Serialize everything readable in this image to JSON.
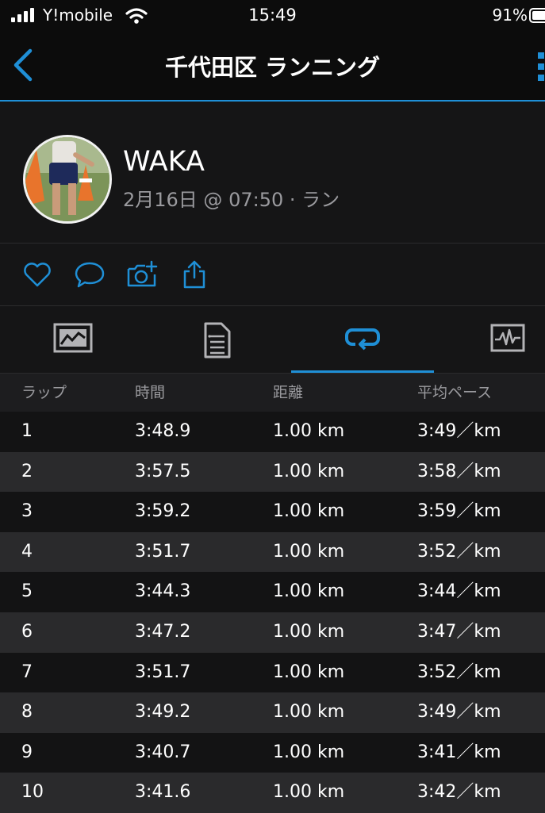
{
  "status_bar": {
    "carrier": "Y!mobile",
    "time": "15:49",
    "battery": "91%"
  },
  "nav": {
    "title": "千代田区 ランニング",
    "accent_color": "#1f8fd6"
  },
  "profile": {
    "name": "WAKA",
    "meta": "2月16日 @ 07:50 · ラン"
  },
  "actions": [
    "heart-icon",
    "comment-icon",
    "camera-add-icon",
    "share-icon"
  ],
  "tabs": [
    {
      "icon": "chart-icon",
      "active": false
    },
    {
      "icon": "document-icon",
      "active": false
    },
    {
      "icon": "laps-icon",
      "active": true
    },
    {
      "icon": "activity-graph-icon",
      "active": false
    }
  ],
  "laps": {
    "headers": {
      "lap": "ラップ",
      "time": "時間",
      "distance": "距離",
      "pace": "平均ペース"
    },
    "rows": [
      {
        "lap": "1",
        "time": "3:48.9",
        "distance": "1.00 km",
        "pace": "3:49／km"
      },
      {
        "lap": "2",
        "time": "3:57.5",
        "distance": "1.00 km",
        "pace": "3:58／km"
      },
      {
        "lap": "3",
        "time": "3:59.2",
        "distance": "1.00 km",
        "pace": "3:59／km"
      },
      {
        "lap": "4",
        "time": "3:51.7",
        "distance": "1.00 km",
        "pace": "3:52／km"
      },
      {
        "lap": "5",
        "time": "3:44.3",
        "distance": "1.00 km",
        "pace": "3:44／km"
      },
      {
        "lap": "6",
        "time": "3:47.2",
        "distance": "1.00 km",
        "pace": "3:47／km"
      },
      {
        "lap": "7",
        "time": "3:51.7",
        "distance": "1.00 km",
        "pace": "3:52／km"
      },
      {
        "lap": "8",
        "time": "3:49.2",
        "distance": "1.00 km",
        "pace": "3:49／km"
      },
      {
        "lap": "9",
        "time": "3:40.7",
        "distance": "1.00 km",
        "pace": "3:41／km"
      },
      {
        "lap": "10",
        "time": "3:41.6",
        "distance": "1.00 km",
        "pace": "3:42／km"
      }
    ]
  }
}
